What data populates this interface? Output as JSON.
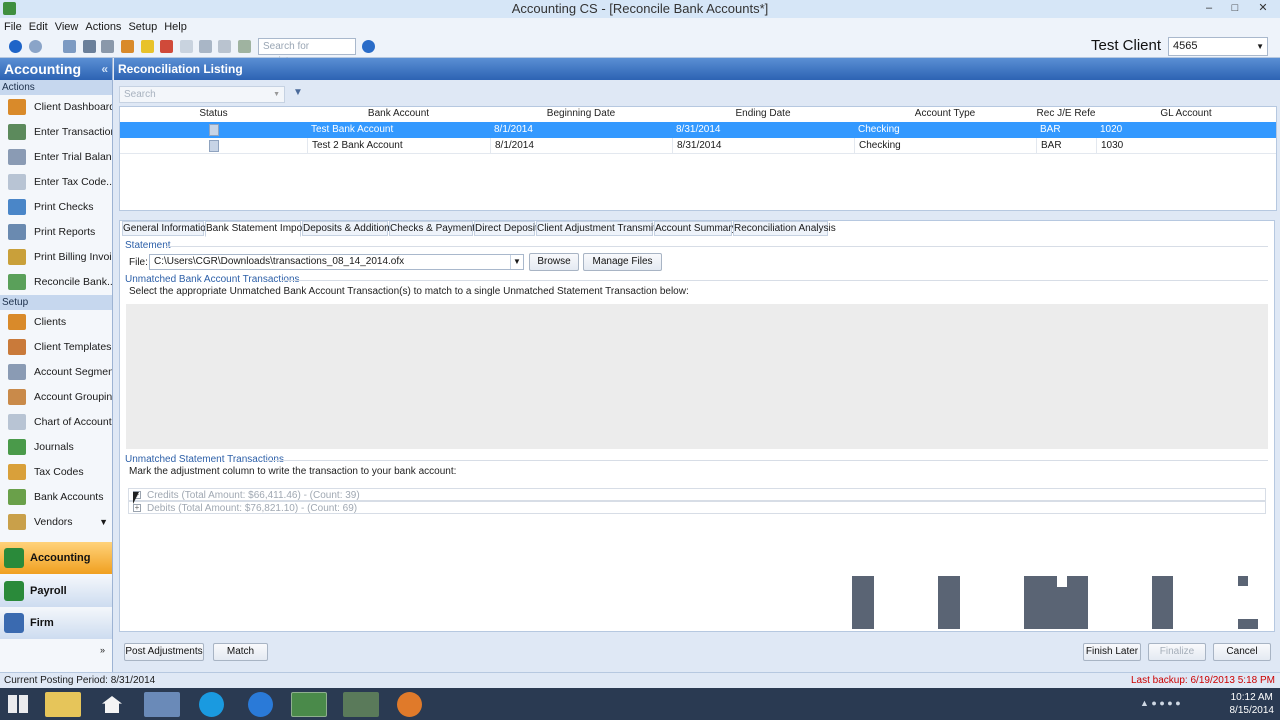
{
  "window": {
    "title": "Accounting CS - [Reconcile Bank Accounts*]"
  },
  "menu": [
    "File",
    "Edit",
    "View",
    "Actions",
    "Setup",
    "Help"
  ],
  "toolbar": {
    "assist_placeholder": "Search for assistance",
    "client_name": "Test Client",
    "client_code": "4565"
  },
  "sidebar": {
    "header": "Accounting",
    "sections": [
      {
        "title": "Actions",
        "items": [
          "Client Dashboard",
          "Enter Transactions",
          "Enter Trial Balan...",
          "Enter Tax Code...",
          "Print Checks",
          "Print Reports",
          "Print Billing Invoi...",
          "Reconcile Bank..."
        ]
      },
      {
        "title": "Setup",
        "items": [
          "Clients",
          "Client Templates",
          "Account Segments",
          "Account Groupin...",
          "Chart of Accounts",
          "Journals",
          "Tax Codes",
          "Bank Accounts",
          "Vendors"
        ]
      }
    ],
    "modules": [
      "Accounting",
      "Payroll",
      "Firm"
    ]
  },
  "main": {
    "title": "Reconciliation Listing",
    "search_placeholder": "Search",
    "columns": [
      "Status",
      "Bank Account",
      "Beginning Date",
      "Ending Date",
      "Account Type",
      "Rec J/E Refe",
      "GL Account"
    ],
    "rows": [
      {
        "bank_account": "Test Bank Account",
        "beginning_date": "8/1/2014",
        "ending_date": "8/31/2014",
        "account_type": "Checking",
        "rec_ref": "BAR",
        "gl_account": "1020",
        "selected": true
      },
      {
        "bank_account": "Test 2 Bank Account",
        "beginning_date": "8/1/2014",
        "ending_date": "8/31/2014",
        "account_type": "Checking",
        "rec_ref": "BAR",
        "gl_account": "1030",
        "selected": false
      }
    ]
  },
  "tabs": [
    "General Information",
    "Bank Statement Import",
    "Deposits & Additions",
    "Checks & Payments",
    "Direct Deposit",
    "Client Adjustment Transmittal",
    "Account Summary",
    "Reconciliation Analysis"
  ],
  "active_tab": "Bank Statement Import",
  "statement": {
    "section_title": "Statement",
    "file_label": "File:",
    "file_path": "C:\\Users\\CGR\\Downloads\\transactions_08_14_2014.ofx",
    "browse": "Browse",
    "manage_files": "Manage Files"
  },
  "unmatched_bank": {
    "title": "Unmatched Bank Account Transactions",
    "instructions": "Select the appropriate Unmatched Bank Account Transaction(s) to match to a single Unmatched Statement Transaction below:"
  },
  "unmatched_statement": {
    "title": "Unmatched Statement Transactions",
    "instructions": "Mark the adjustment column to write the transaction to your bank account:",
    "groups": [
      "Credits (Total Amount: $66,411.46) - (Count: 39)",
      "Debits (Total Amount: $76,821.10) - (Count: 69)"
    ]
  },
  "buttons": {
    "post_adjustments": "Post Adjustments",
    "match": "Match",
    "finish_later": "Finish Later",
    "finalize": "Finalize",
    "cancel": "Cancel"
  },
  "status": {
    "posting_period": "Current Posting Period: 8/31/2014",
    "last_backup": "Last backup: 6/19/2013 5:18 PM"
  },
  "clock": {
    "time": "10:12 AM",
    "date": "8/15/2014"
  },
  "colors": {
    "header_blue": "#2d63b3",
    "selected_row": "#3399ff",
    "accounting_tab": "#f0a020",
    "backup_red": "#cc0000"
  }
}
